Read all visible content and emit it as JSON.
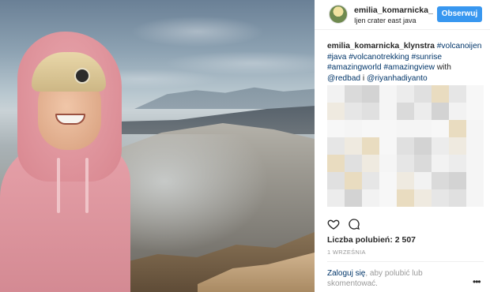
{
  "header": {
    "username": "emilia_komarnicka_",
    "location": "Ijen crater east java",
    "follow_label": "Obserwuj"
  },
  "caption": {
    "author": "emilia_komarnicka_klynstra",
    "hashtags": [
      "#volcanoije",
      "n #java",
      "#volcanotrekking",
      "#sunrise",
      "#amazingworld",
      "#amazingview"
    ],
    "text_with": " with",
    "mention_1": "@redbad",
    "text_and": " i ",
    "mention_2": "@riyanhadiyanto"
  },
  "actions": {
    "like_icon": "heart-icon",
    "comment_icon": "comment-icon"
  },
  "likes_text": "Liczba polubień: 2 507",
  "date_text": "1 WRZEŚNIA",
  "footer": {
    "login_link": "Zaloguj się",
    "login_rest": ", aby polubić lub skomentować.",
    "more_icon": "more-options-icon",
    "more_glyph": "•••"
  },
  "colors": {
    "follow_button": "#3897f0",
    "link": "#003569",
    "muted": "#999999"
  }
}
